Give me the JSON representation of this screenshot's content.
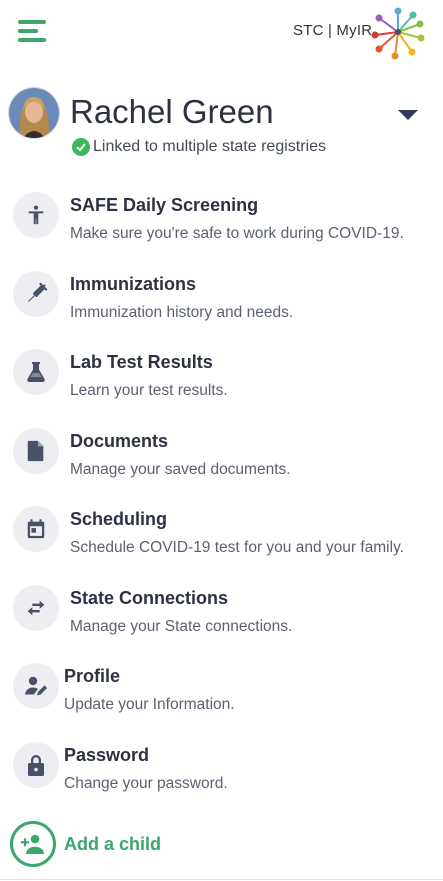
{
  "header": {
    "menu_icon": "hamburger-menu-icon",
    "logo_text": "STC | MyIR",
    "logo_icon": "starburst-logo"
  },
  "user": {
    "name": "Rachel Green",
    "linked_status": "Linked to multiple state registries",
    "status_color": "#3bb85f"
  },
  "menu": {
    "items": [
      {
        "title": "SAFE Daily Screening",
        "desc": "Make sure you're safe to work during COVID-19.",
        "icon": "person-standing-icon"
      },
      {
        "title": "Immunizations",
        "desc": "Immunization history and needs.",
        "icon": "syringe-icon"
      },
      {
        "title": "Lab Test Results",
        "desc": "Learn your test results.",
        "icon": "flask-icon"
      },
      {
        "title": "Documents",
        "desc": "Manage your saved documents.",
        "icon": "document-icon"
      },
      {
        "title": "Scheduling",
        "desc": "Schedule COVID-19 test for you and your family.",
        "icon": "calendar-icon"
      },
      {
        "title": "State Connections",
        "desc": "Manage your State connections.",
        "icon": "swap-arrows-icon"
      },
      {
        "title": "Profile",
        "desc": "Update your Information.",
        "icon": "person-edit-icon"
      },
      {
        "title": "Password",
        "desc": "Change your password.",
        "icon": "lock-icon"
      }
    ]
  },
  "add_child": {
    "label": "Add a child",
    "icon": "add-person-icon"
  },
  "colors": {
    "accent": "#3aa76d",
    "text": "#2d3142",
    "icon_bg": "#eeeef2",
    "icon": "#4a5068"
  }
}
